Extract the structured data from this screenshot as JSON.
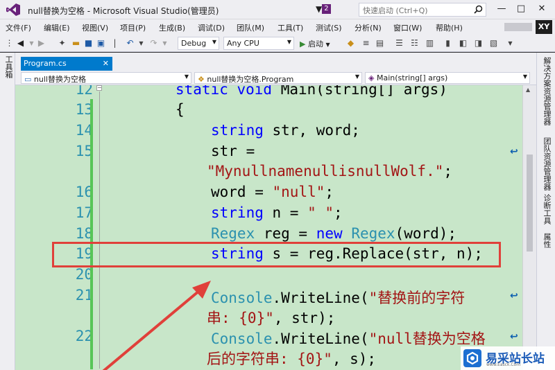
{
  "window": {
    "title": "null替换为空格 - Microsoft Visual Studio(管理员)",
    "notification_count": "2",
    "quick_launch_placeholder": "快速启动 (Ctrl+Q)",
    "minimize_label": "—",
    "maximize_label": "□",
    "close_label": "✕"
  },
  "menu": [
    "文件(F)",
    "编辑(E)",
    "视图(V)",
    "项目(P)",
    "生成(B)",
    "调试(D)",
    "团队(M)",
    "工具(T)",
    "测试(S)",
    "分析(N)",
    "窗口(W)",
    "帮助(H)"
  ],
  "account": {
    "initials": "XY"
  },
  "toolbar": {
    "config": "Debug",
    "platform": "Any CPU",
    "start_label": "启动"
  },
  "left_panel": {
    "label": "工具箱"
  },
  "right_panel": {
    "labels": [
      "解决方案资源管理器",
      "团队资源管理器",
      "诊断工具",
      "属性"
    ]
  },
  "document_tab": {
    "label": "Program.cs",
    "close": "✕"
  },
  "nav": {
    "project": "null替换为空格",
    "class": "null替换为空格.Program",
    "member": "Main(string[] args)"
  },
  "editor": {
    "line_numbers": [
      "12",
      "13",
      "14",
      "15",
      "16",
      "17",
      "18",
      "19",
      "20",
      "21",
      "22"
    ],
    "code": {
      "l12_kw": "static void",
      "l12_rest": " Main(string[] args)",
      "l13": "{",
      "l14_kw": "string",
      "l14_rest": " str, word;",
      "l15_a": "str =",
      "l15_str": "\"MynullnamenullisnullWolf.\"",
      "l15_end": ";",
      "l16_a": "word = ",
      "l16_str": "\"null\"",
      "l16_end": ";",
      "l17_kw": "string",
      "l17_a": " n = ",
      "l17_str": "\" \"",
      "l17_end": ";",
      "l18_tp1": "Regex",
      "l18_a": " reg = ",
      "l18_kw": "new",
      "l18_sp": " ",
      "l18_tp2": "Regex",
      "l18_end": "(word);",
      "l19_kw": "string",
      "l19_rest": " s = reg.Replace(str, n);",
      "l21_tp": "Console",
      "l21_a": ".WriteLine(",
      "l21_str": "\"替换前的字符",
      "l21b_str": "串: {0}\"",
      "l21b_end": ", str);",
      "l22_tp": "Console",
      "l22_a": ".WriteLine(",
      "l22_str": "\"null替换为空格",
      "l22b_str": "后的字符串: {0}\"",
      "l22b_end": ", s);"
    }
  },
  "watermark": {
    "text": "易采站长站",
    "sub": "www.Easck.Com"
  },
  "colors": {
    "accent": "#007acc",
    "editor_bg": "#c8e6c9",
    "highlight": "#e0403a",
    "keyword": "#0000ff",
    "type": "#2b91af",
    "string": "#a31515"
  }
}
